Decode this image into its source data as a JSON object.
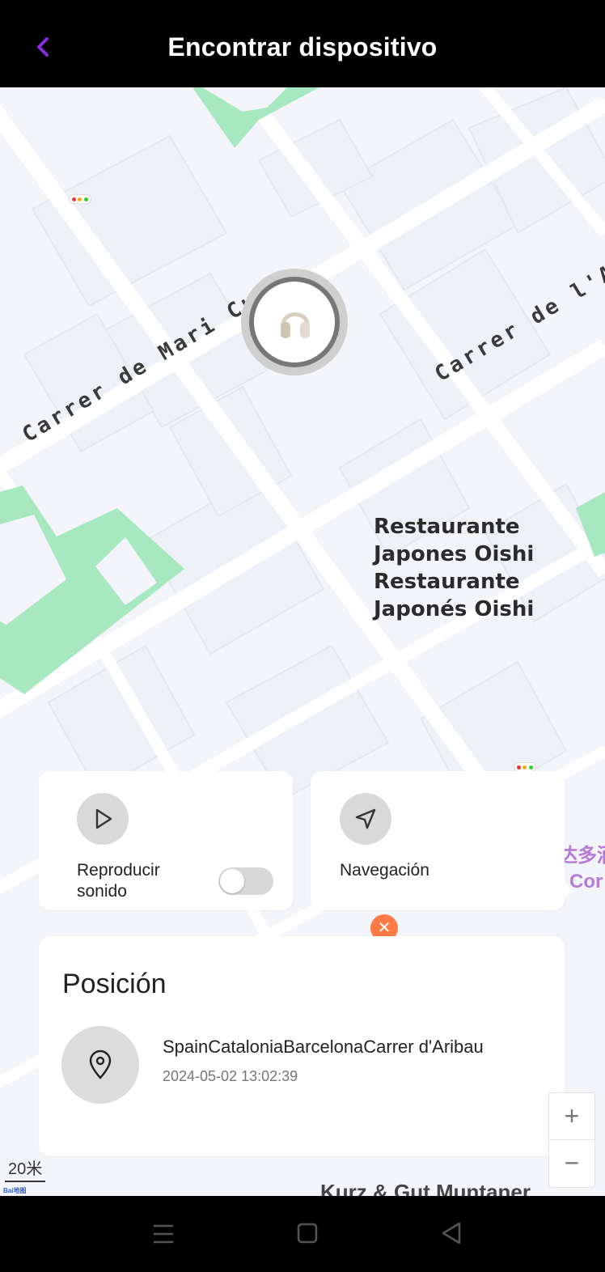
{
  "header": {
    "title": "Encontrar dispositivo",
    "back_icon": "chevron-left-icon"
  },
  "colors": {
    "accent": "#8a2be2",
    "park": "#a8e8c0",
    "poi_purple": "#b57bd8",
    "food_pin": "#ff7a45"
  },
  "map": {
    "streets": [
      "Carrer de Mari Cub",
      "Carrer de l'Av"
    ],
    "poi": [
      "Restaurante",
      "Japones Oishi",
      "Restaurante",
      "Japonés Oishi"
    ],
    "chinese_poi": [
      "达多酒",
      "Cor"
    ],
    "bottom_label": "Kurz & Gut Muntaner",
    "scale": "20米",
    "logo": "Bai地图",
    "device_icon": "headphones-icon",
    "zoom_in": "+",
    "zoom_out": "−"
  },
  "actions": {
    "sound": {
      "label": "Reproducir sonido",
      "icon": "play-icon",
      "toggle_on": false
    },
    "navigation": {
      "label": "Navegación",
      "icon": "navigation-arrow-icon"
    }
  },
  "position": {
    "heading": "Posición",
    "address": "SpainCataloniaBarcelonaCarrer d'Aribau",
    "timestamp": "2024-05-02 13:02:39",
    "icon": "location-pin-icon"
  }
}
